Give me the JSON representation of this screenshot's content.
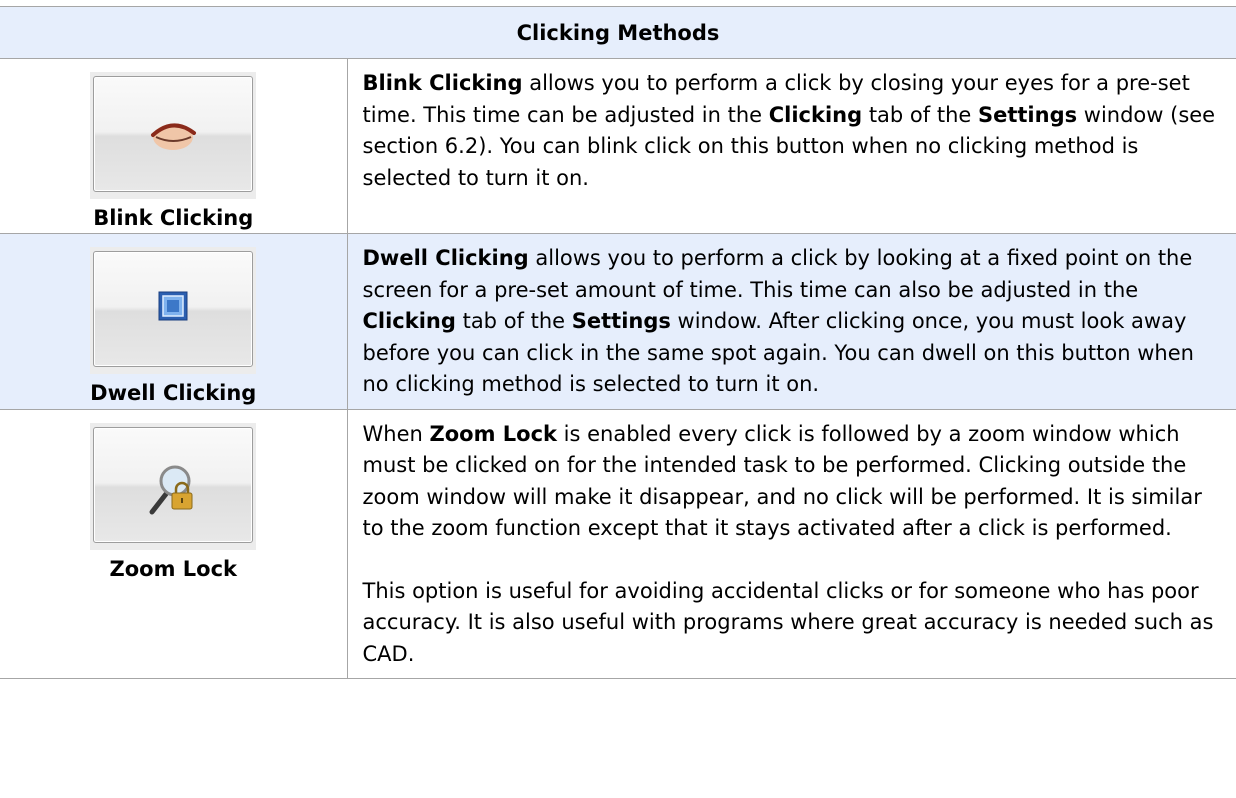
{
  "table": {
    "title": "Clicking Methods",
    "rows": [
      {
        "icon": "eye-closed-icon",
        "label": "Blink Clicking",
        "paragraphs": [
          [
            {
              "b": true,
              "t": "Blink Clicking"
            },
            {
              "b": false,
              "t": " allows you to perform a click by closing your eyes for a pre-set time.  This time can be adjusted in the "
            },
            {
              "b": true,
              "t": "Clicking"
            },
            {
              "b": false,
              "t": " tab of the "
            },
            {
              "b": true,
              "t": "Settings"
            },
            {
              "b": false,
              "t": " window (see section 6.2).  You can blink click on this button when no clicking method is selected to turn it on."
            }
          ]
        ]
      },
      {
        "icon": "dwell-square-icon",
        "label": "Dwell Clicking",
        "paragraphs": [
          [
            {
              "b": true,
              "t": "Dwell Clicking"
            },
            {
              "b": false,
              "t": " allows you to perform a click by looking at a fixed point on the screen for a pre-set amount of time.  This time can also be adjusted in the "
            },
            {
              "b": true,
              "t": "Clicking"
            },
            {
              "b": false,
              "t": " tab of the "
            },
            {
              "b": true,
              "t": "Settings"
            },
            {
              "b": false,
              "t": " window.  After clicking once, you must look away before you can click in the same spot again.  You can dwell on this button when no clicking method is selected to turn it on."
            }
          ]
        ]
      },
      {
        "icon": "magnifier-lock-icon",
        "label": "Zoom Lock",
        "paragraphs": [
          [
            {
              "b": false,
              "t": "When "
            },
            {
              "b": true,
              "t": "Zoom Lock"
            },
            {
              "b": false,
              "t": " is enabled every click is followed by a zoom window which must be clicked on for the intended task to be performed.  Clicking outside the zoom window will make it disappear, and no click will be performed.  It is similar to the zoom function except that it stays activated after a click is performed."
            }
          ],
          [
            {
              "b": false,
              "t": "This option is useful for avoiding accidental clicks or for someone who has poor accuracy.  It is also useful with programs where great accuracy is needed such as CAD."
            }
          ]
        ]
      }
    ]
  }
}
